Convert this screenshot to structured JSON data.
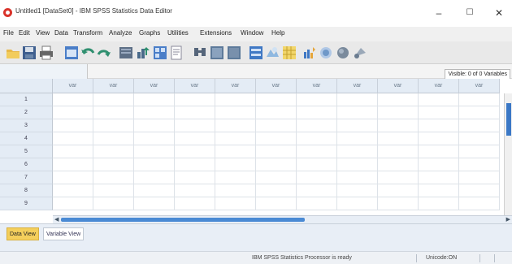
{
  "window": {
    "title": "Untitled1 [DataSet0] - IBM SPSS Statistics Data Editor",
    "minimize": "–",
    "maximize": "☐",
    "close": "✕"
  },
  "menu": [
    {
      "label": "File"
    },
    {
      "label": "Edit"
    },
    {
      "label": "View"
    },
    {
      "label": "Data"
    },
    {
      "label": "Transform"
    },
    {
      "label": "Analyze"
    },
    {
      "label": "Graphs"
    },
    {
      "label": "Utilities"
    },
    {
      "label": "Extensions"
    },
    {
      "label": "Window"
    },
    {
      "label": "Help"
    }
  ],
  "toolbar": {
    "icons": [
      "open-folder-icon",
      "save-icon",
      "print-icon",
      "dialog-recall-icon",
      "undo-icon",
      "redo-icon",
      "goto-case-icon",
      "goto-variable-icon",
      "variables-icon",
      "run-descriptives-icon",
      "find-icon",
      "insert-cases-icon",
      "insert-variable-icon",
      "split-file-icon",
      "weight-cases-icon",
      "select-cases-icon",
      "value-labels-icon",
      "use-variable-sets-icon",
      "show-all-variables-icon",
      "spelling-icon"
    ]
  },
  "editor": {
    "visible_label": "Visible: 0 of 0 Variables"
  },
  "grid": {
    "column_header": "var",
    "columns": [
      "var",
      "var",
      "var",
      "var",
      "var",
      "var",
      "var",
      "var",
      "var",
      "var",
      "var"
    ],
    "rows": [
      "1",
      "2",
      "3",
      "4",
      "5",
      "6",
      "7",
      "8",
      "9"
    ]
  },
  "tabs": {
    "data_view": "Data View",
    "variable_view": "Variable View"
  },
  "status": {
    "processor": "IBM SPSS Statistics Processor is ready",
    "unicode": "Unicode:ON"
  },
  "colors": {
    "active_tab": "#f4cf5c",
    "header_bg": "#e4ecf5",
    "scroll_thumb": "#3b78c6"
  }
}
